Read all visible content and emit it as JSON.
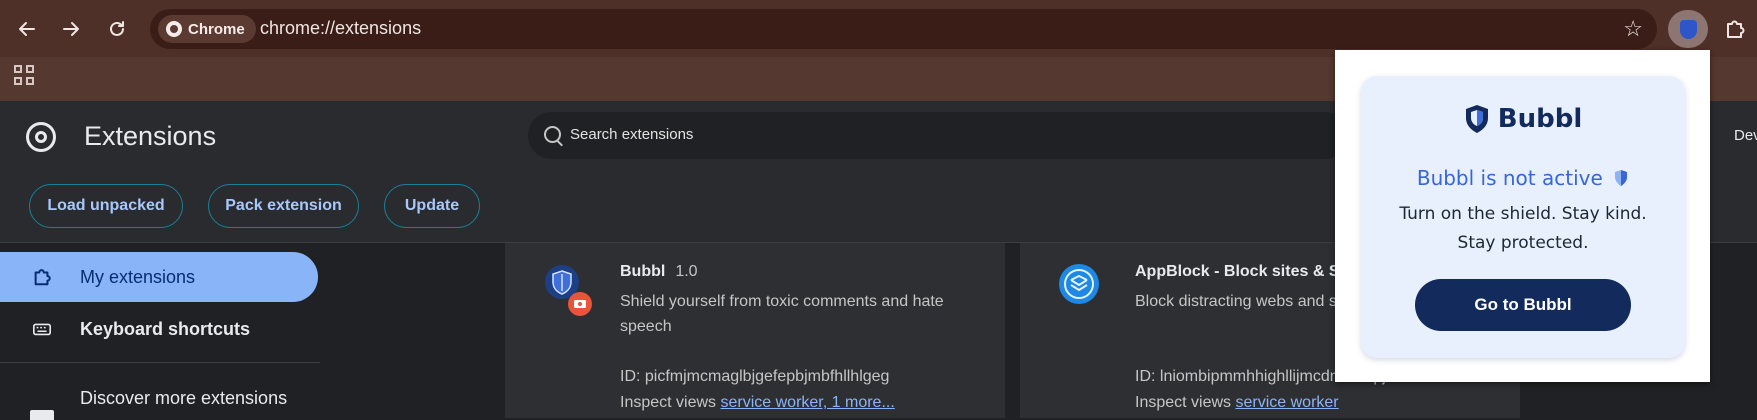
{
  "browser": {
    "chip_label": "Chrome",
    "url": "chrome://extensions"
  },
  "header": {
    "title": "Extensions",
    "search_placeholder": "Search extensions",
    "developer_mode_label": "Dev",
    "buttons": {
      "load_unpacked": "Load unpacked",
      "pack_extension": "Pack extension",
      "update": "Update"
    }
  },
  "sidebar": {
    "items": [
      {
        "label": "My extensions"
      },
      {
        "label": "Keyboard shortcuts"
      }
    ],
    "discover": "Discover more extensions"
  },
  "extensions": [
    {
      "name": "Bubbl",
      "version": "1.0",
      "description": "Shield yourself from toxic comments and hate speech",
      "id": "ID: picfmjmcmaglbjgefepbjmbfhllhlgeg",
      "inspect_prefix": "Inspect views",
      "inspect_link": "service worker, 1 more..."
    },
    {
      "name": "AppBlock - Block sites & Sta",
      "description": "Block distracting webs and s work.",
      "id": "ID: lniombipmmhhighllijmcdnencnpj.er",
      "inspect_prefix": "Inspect views",
      "inspect_link": "service worker"
    }
  ],
  "popup": {
    "brand": "Bubbl",
    "status": "Bubbl is not active",
    "tagline": "Turn on the shield. Stay kind. Stay protected.",
    "button": "Go to Bubbl"
  },
  "colors": {
    "accent": "#8ab4f8",
    "popup_navy": "#122a5c",
    "popup_status": "#3766d8"
  }
}
